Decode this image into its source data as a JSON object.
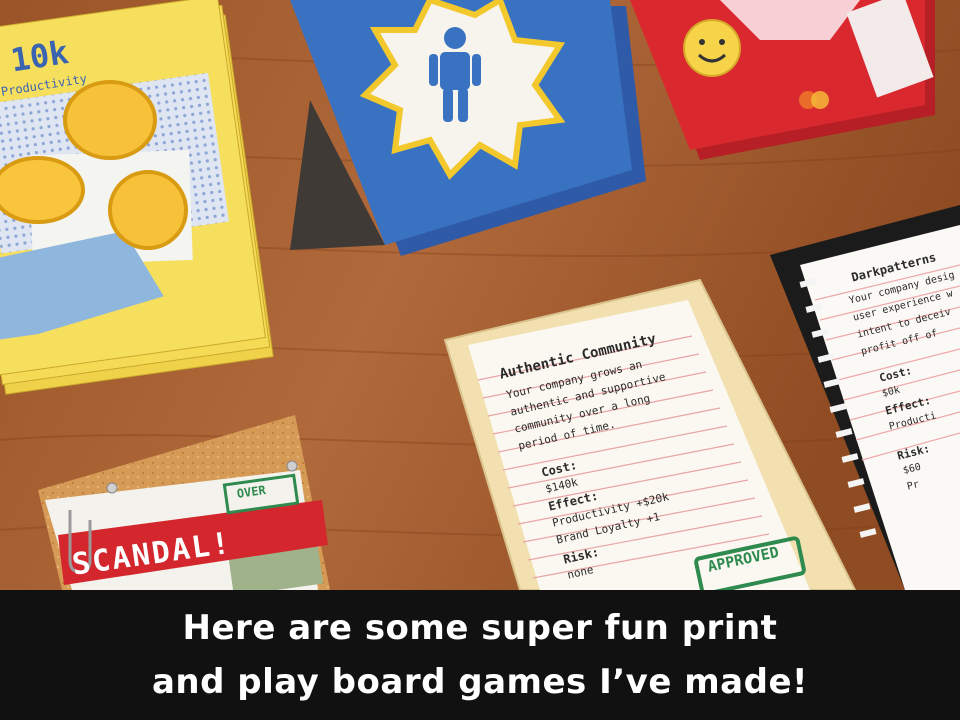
{
  "photo": {
    "cards": {
      "productivity": {
        "title": "10k",
        "subtitle": "Productivity"
      },
      "community": {
        "title": "Authentic Community",
        "description": [
          "Your company grows an",
          "authentic and supportive",
          "community over a long",
          "period of time."
        ],
        "cost_label": "Cost:",
        "cost_value": "$140k",
        "effect_label": "Effect:",
        "effect_lines": [
          "Productivity +$20k",
          "Brand Loyalty +1"
        ],
        "risk_label": "Risk:",
        "risk_value": "none",
        "stamp": "APPROVED"
      },
      "darkpatterns": {
        "title": "Darkpatterns",
        "description": [
          "Your company desig",
          "user experience w",
          "intent to deceiv",
          "profit off of"
        ],
        "cost_label": "Cost:",
        "cost_value": "$0k",
        "effect_label": "Effect:",
        "effect_value": "Producti",
        "risk_label": "Risk:",
        "risk_lines": [
          "$60",
          "Pr"
        ]
      },
      "scandal": {
        "title": "SCANDAL!",
        "stamp": "OVER"
      }
    }
  },
  "caption": {
    "line1": "Here are some super fun print",
    "line2": "and play board games I’ve made!"
  },
  "colors": {
    "table": "#a45a2e",
    "caption_bg": "#111111",
    "caption_text": "#ffffff",
    "scandal_red": "#d3272d",
    "approved_green": "#2e8a4f"
  }
}
